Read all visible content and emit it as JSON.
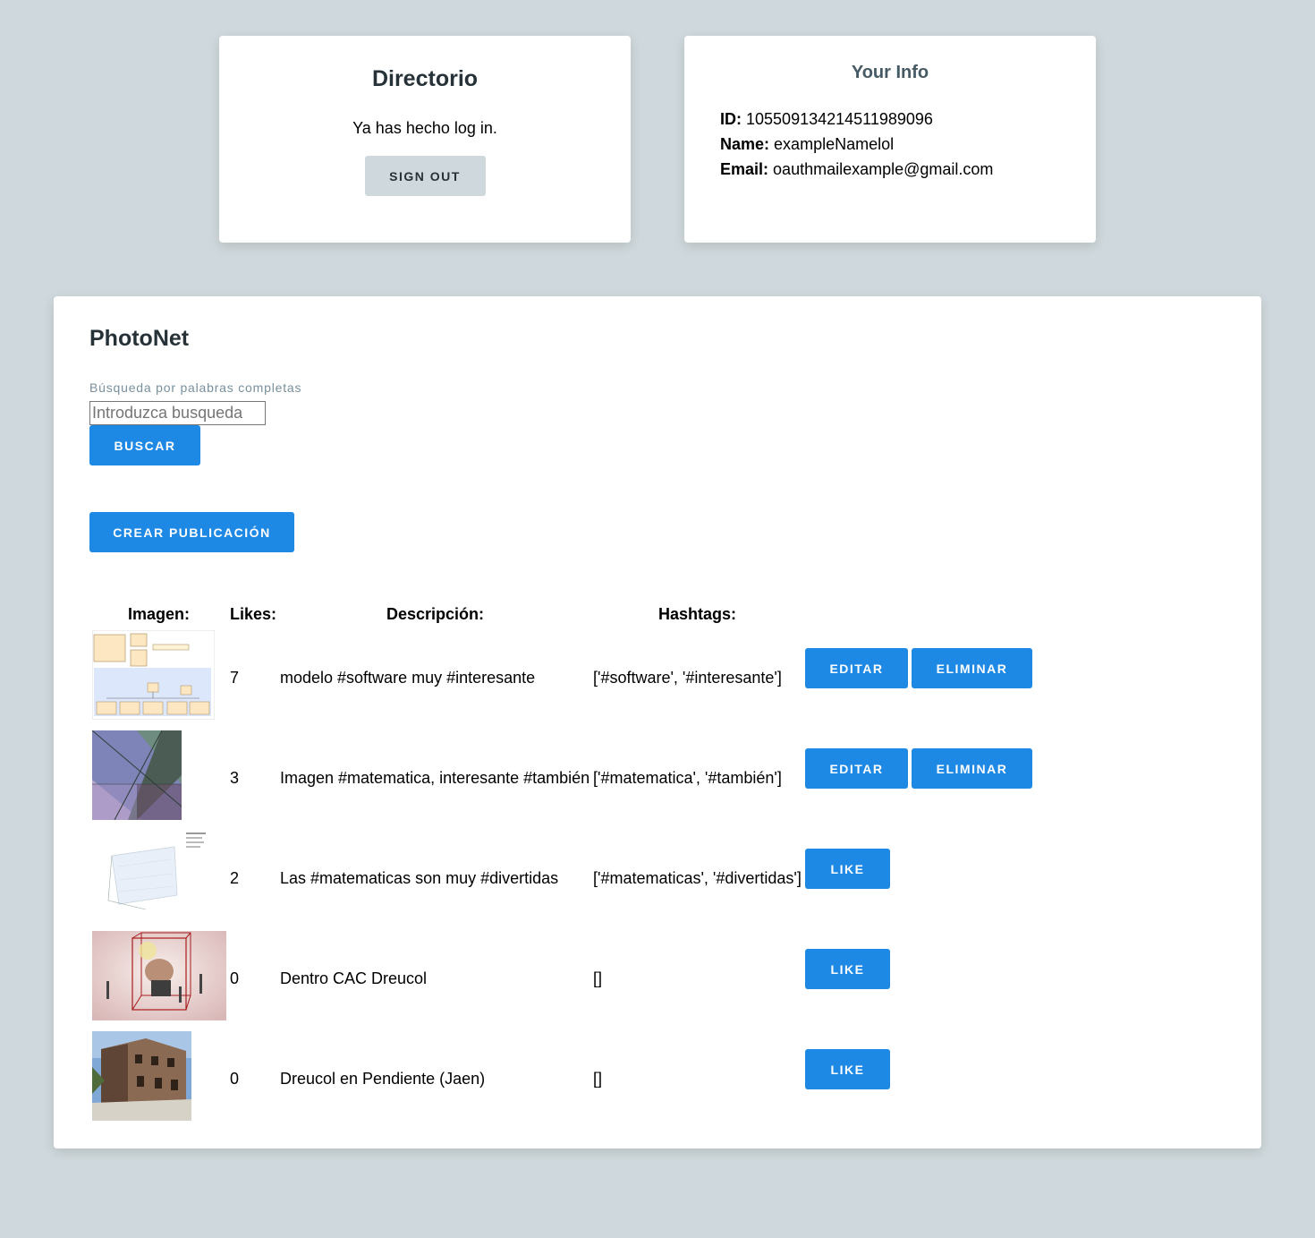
{
  "auth_card": {
    "title": "Directorio",
    "message": "Ya has hecho log in.",
    "sign_out_label": "Sign Out"
  },
  "info_card": {
    "title": "Your Info",
    "id_label": "ID:",
    "id_value": "105509134214511989096",
    "name_label": "Name:",
    "name_value": "exampleNamelol",
    "email_label": "Email:",
    "email_value": "oauthmailexample@gmail.com"
  },
  "photonet": {
    "title": "PhotoNet",
    "search": {
      "label": "Búsqueda por palabras completas",
      "placeholder": "Introduzca busqueda",
      "value": "",
      "button": "Buscar"
    },
    "create_button": "Crear Publicación",
    "table": {
      "headers": {
        "image": "Imagen:",
        "likes": "Likes:",
        "description": "Descripción:",
        "hashtags": "Hashtags:"
      },
      "rows": [
        {
          "image": "uml-diagram-image",
          "likes": "7",
          "description": "modelo #software muy #interesante",
          "hashtags": "['#software', '#interesante']",
          "actions": [
            "Editar",
            "Eliminar"
          ]
        },
        {
          "image": "geometry-lines-image",
          "likes": "3",
          "description": "Imagen #matematica, interesante #también",
          "hashtags": "['#matematica', '#también']",
          "actions": [
            "Editar",
            "Eliminar"
          ]
        },
        {
          "image": "3d-plot-image",
          "likes": "2",
          "description": "Las #matematicas son muy #divertidas",
          "hashtags": "['#matematicas', '#divertidas']",
          "actions": [
            "Like"
          ]
        },
        {
          "image": "figure-in-cube-image",
          "likes": "0",
          "description": "Dentro CAC Dreucol",
          "hashtags": "[]",
          "actions": [
            "Like"
          ]
        },
        {
          "image": "old-building-photo",
          "likes": "0",
          "description": "Dreucol en Pendiente (Jaen)",
          "hashtags": "[]",
          "actions": [
            "Like"
          ]
        }
      ]
    }
  }
}
